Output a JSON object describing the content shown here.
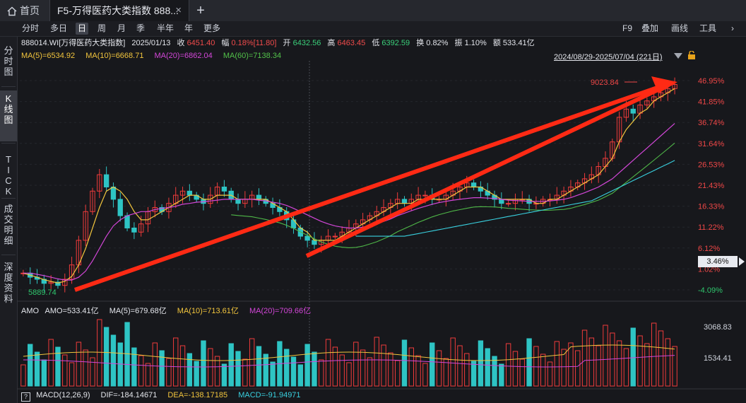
{
  "tabs": {
    "home_label": "首页",
    "active_label": "F5-万得医药大类指数 888...",
    "close_symbol": "×",
    "add_symbol": "+"
  },
  "periods": [
    "分时",
    "多日",
    "日",
    "周",
    "月",
    "季",
    "半年",
    "年",
    "更多"
  ],
  "active_period": "日",
  "right_toolbar": [
    "F9",
    "叠加",
    "画线",
    "工具"
  ],
  "right_toolbar_more": "›",
  "sidebar": [
    [
      "分",
      "时",
      "图"
    ],
    [
      "K",
      "线",
      "图"
    ],
    [
      "T",
      "I",
      "C",
      "K"
    ],
    [
      "成",
      "交",
      "明",
      "细"
    ],
    [
      "深",
      "度",
      "资",
      "料"
    ]
  ],
  "info": {
    "symbol": "888014.WI[万得医药大类指数]",
    "date": "2025/01/13",
    "close_label": "收",
    "close": "6451.40",
    "amp_label": "幅",
    "amp": "0.18%[11.80]",
    "open_label": "开",
    "open": "6432.56",
    "high_label": "高",
    "high": "6463.45",
    "low_label": "低",
    "low": "6392.59",
    "turnover_label": "换",
    "turnover": "0.82%",
    "swing_label": "振",
    "swing": "1.10%",
    "amount_label": "额",
    "amount": "533.41亿"
  },
  "ma": {
    "ma5": "MA(5)=6534.92",
    "ma10": "MA(10)=6668.71",
    "ma20": "MA(20)=6862.04",
    "ma60": "MA(60)=7138.34"
  },
  "date_range": "2024/08/29-2025/07/04 (221日)",
  "current_price_tag": "3.46%",
  "amo": {
    "label": "AMO",
    "amo": "AMO=533.41亿",
    "ma5": "MA(5)=679.68亿",
    "ma10": "MA(10)=713.61亿",
    "ma20": "MA(20)=709.66亿"
  },
  "macd": {
    "help": "?",
    "label": "MACD(12,26,9)",
    "dif": "DIF=-184.14671",
    "dea": "DEA=-138.17185",
    "macd": "MACD=-91.94971"
  },
  "chart_data": {
    "type": "candlestick",
    "y_axis_ticks": [
      "46.95%",
      "41.85%",
      "36.74%",
      "31.64%",
      "26.53%",
      "21.43%",
      "16.33%",
      "11.22%",
      "6.12%",
      "1.02%",
      "-4.09%"
    ],
    "annotations": {
      "high": "9023.84",
      "low": "5889.74"
    },
    "volume_ticks": [
      "3068.83",
      "1534.41"
    ],
    "y_range_pct": [
      -4.09,
      46.95
    ],
    "close_pct": [
      0,
      -1,
      -1.5,
      -2.5,
      -2.2,
      -3,
      -1.5,
      2,
      8,
      15,
      20,
      24,
      21,
      18,
      14,
      11,
      10,
      12,
      15,
      16,
      15,
      17,
      19,
      20,
      19,
      18,
      17,
      19,
      21,
      20,
      18,
      17,
      18,
      19,
      18,
      17,
      16,
      15,
      13,
      11,
      9,
      8,
      7,
      8,
      9,
      9,
      10,
      11,
      12,
      13,
      14,
      15,
      16,
      17,
      18,
      17,
      18,
      19,
      19,
      18,
      18,
      19,
      20,
      21,
      22,
      21,
      20,
      19,
      18,
      17,
      17,
      18,
      18,
      17,
      17,
      18,
      18,
      19,
      20,
      21,
      22,
      23,
      24,
      26,
      28,
      32,
      38,
      40,
      39,
      41,
      42,
      43,
      44,
      45,
      46
    ],
    "ma5_pct": [
      0,
      -0.5,
      -1,
      -1.6,
      -2,
      -2.4,
      -2,
      -0.8,
      2,
      6,
      11,
      16,
      20,
      21,
      20,
      18,
      15,
      13,
      13,
      14,
      15,
      16,
      17,
      18,
      19,
      19,
      18,
      18,
      19,
      19,
      19,
      18,
      18,
      18,
      18,
      18,
      17,
      16,
      15,
      13,
      11,
      10,
      8,
      8,
      8,
      8,
      9,
      10,
      11,
      12,
      13,
      14,
      15,
      16,
      17,
      17,
      17,
      18,
      18,
      18,
      18,
      18,
      19,
      20,
      21,
      21,
      21,
      20,
      19,
      18,
      18,
      18,
      18,
      18,
      17,
      17,
      18,
      18,
      19,
      20,
      21,
      22,
      23,
      24,
      26,
      28,
      32,
      35,
      37,
      39,
      40,
      42,
      43,
      44,
      45
    ],
    "ma20_pct": [
      0,
      0,
      -0.3,
      -0.6,
      -1,
      -1.4,
      -1.7,
      -1.7,
      -1,
      0.5,
      3,
      6,
      9,
      11.5,
      13,
      14,
      14.5,
      15,
      15,
      15.5,
      15.8,
      16,
      16.3,
      16.8,
      17,
      17.3,
      17.4,
      17.6,
      17.8,
      18,
      18,
      18,
      18,
      18,
      17.8,
      17.6,
      17.3,
      17,
      16.5,
      15.8,
      15,
      14.2,
      13.4,
      12.6,
      12,
      11.5,
      11.2,
      11,
      11,
      11.2,
      11.6,
      12,
      12.6,
      13.2,
      14,
      14.6,
      15.2,
      15.8,
      16.3,
      16.8,
      17.2,
      17.5,
      17.8,
      18,
      18.2,
      18.4,
      18.4,
      18.3,
      18.2,
      18,
      17.8,
      17.7,
      17.6,
      17.5,
      17.5,
      17.5,
      17.6,
      17.8,
      18,
      18.4,
      19,
      19.6,
      20.3,
      21,
      22,
      23,
      24.5,
      26,
      27.5,
      29,
      30.5,
      32,
      33.5,
      35,
      36.5
    ]
  }
}
